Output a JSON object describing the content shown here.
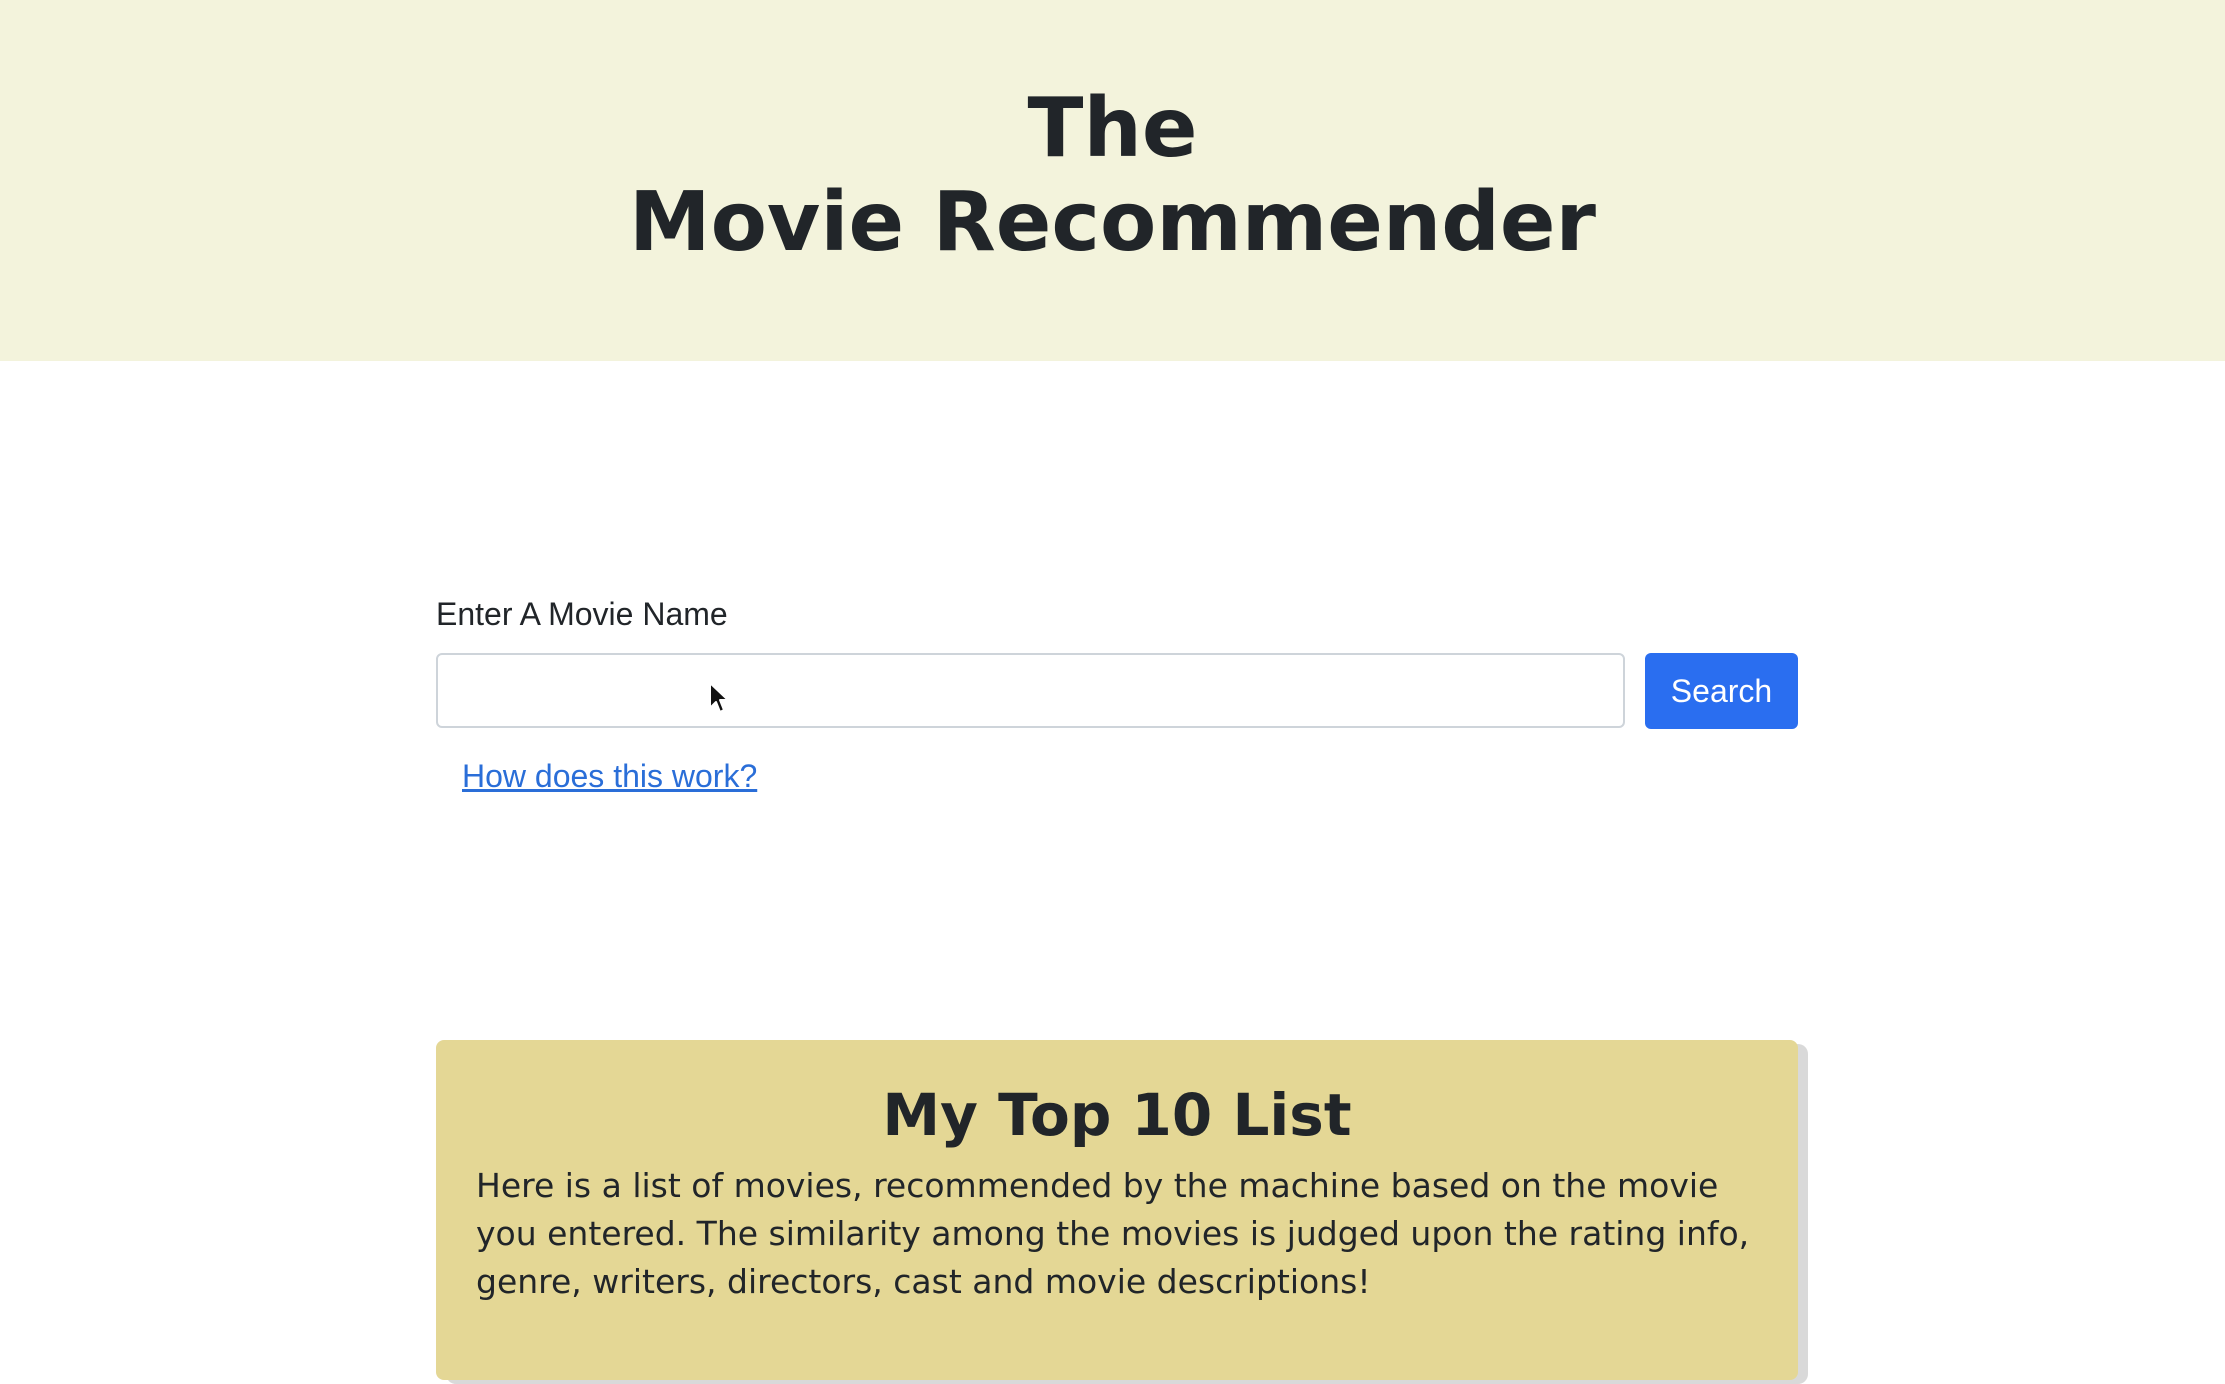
{
  "header": {
    "title_line1": "The",
    "title_line2": "Movie Recommender"
  },
  "search": {
    "label": "Enter A Movie Name",
    "value": "",
    "placeholder": "",
    "button_label": "Search",
    "help_link": "How does this work?"
  },
  "top_list": {
    "title": "My Top 10 List",
    "description": "Here is a list of movies, recommended by the machine based on the movie you entered. The similarity among the movies is judged upon the rating info, genre, writers, directors, cast and movie descriptions!"
  },
  "colors": {
    "header_bg": "#f3f3dc",
    "accent": "#2a6ef0",
    "card_bg": "#e4d795",
    "link": "#2a6ed8"
  },
  "icons": {
    "cursor": "mouse-pointer-icon"
  }
}
